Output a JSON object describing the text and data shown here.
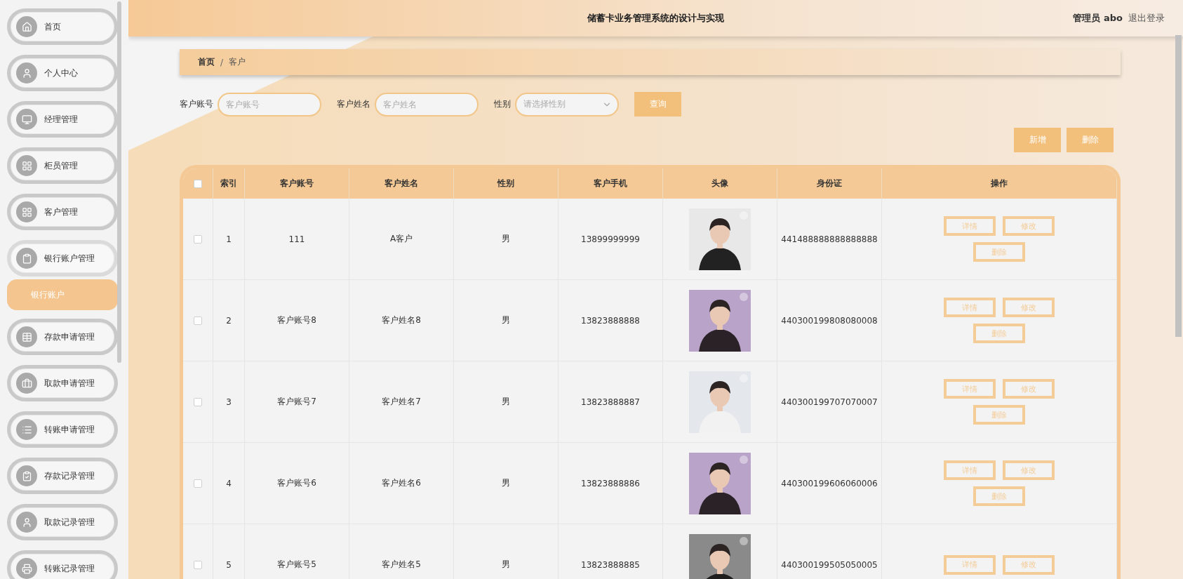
{
  "sidebar": {
    "items": [
      {
        "label": "首页"
      },
      {
        "label": "个人中心"
      },
      {
        "label": "经理管理"
      },
      {
        "label": "柜员管理"
      },
      {
        "label": "客户管理"
      },
      {
        "label": "银行账户管理",
        "expanded": true,
        "children": [
          {
            "label": "银行账户",
            "selected": true
          }
        ]
      },
      {
        "label": "存款申请管理"
      },
      {
        "label": "取款申请管理"
      },
      {
        "label": "转账申请管理"
      },
      {
        "label": "存款记录管理"
      },
      {
        "label": "取款记录管理"
      },
      {
        "label": "转账记录管理"
      }
    ]
  },
  "header": {
    "title": "储蓄卡业务管理系统的设计与实现",
    "user": "管理员 abo",
    "logout": "退出登录"
  },
  "breadcrumb": [
    "首页",
    "/",
    "客户"
  ],
  "search": {
    "fields": [
      {
        "label": "客户账号",
        "placeholder": "客户账号",
        "kind": "input"
      },
      {
        "label": "客户姓名",
        "placeholder": "客户姓名",
        "kind": "input"
      },
      {
        "label": "性别",
        "placeholder": "请选择性别",
        "kind": "select"
      }
    ],
    "button": "查询"
  },
  "toolbar": [
    "新增",
    "删除"
  ],
  "table": {
    "select_all_checked": false,
    "columns": [
      "索引",
      "客户账号",
      "客户姓名",
      "性别",
      "客户手机",
      "头像",
      "身份证",
      "操作"
    ],
    "rows": [
      {
        "checked": false,
        "cells": [
          "1",
          "111",
          "A客户",
          "男",
          "13899999999",
          "441488888888888888"
        ],
        "actions": [
          "详情",
          "修改",
          "删除"
        ]
      },
      {
        "checked": false,
        "cells": [
          "2",
          "客户账号8",
          "客户姓名8",
          "男",
          "13823888888",
          "440300199808080008"
        ],
        "actions": [
          "详情",
          "修改",
          "删除"
        ]
      },
      {
        "checked": false,
        "cells": [
          "3",
          "客户账号7",
          "客户姓名7",
          "男",
          "13823888887",
          "440300199707070007"
        ],
        "actions": [
          "详情",
          "修改",
          "删除"
        ]
      },
      {
        "checked": false,
        "cells": [
          "4",
          "客户账号6",
          "客户姓名6",
          "男",
          "13823888886",
          "440300199606060006"
        ],
        "actions": [
          "详情",
          "修改",
          "删除"
        ]
      },
      {
        "checked": false,
        "cells": [
          "5",
          "客户账号5",
          "客户姓名5",
          "男",
          "13823888885",
          "440300199505050005"
        ],
        "actions": [
          "详情",
          "修改"
        ]
      }
    ]
  }
}
